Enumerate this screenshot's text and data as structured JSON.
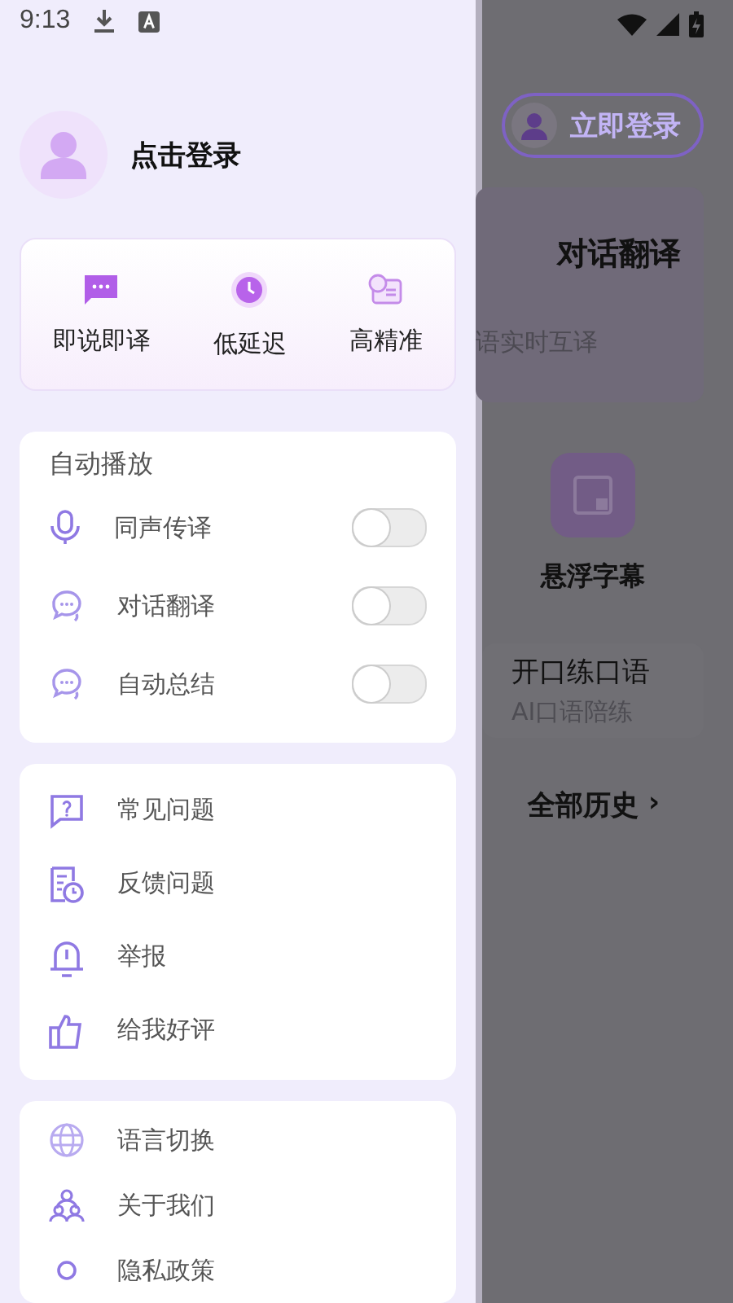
{
  "status_bar": {
    "time": "9:13"
  },
  "drawer": {
    "user": {
      "label": "点击登录"
    },
    "features": [
      {
        "label": "即说即译",
        "kind": "chat"
      },
      {
        "label": "低延迟",
        "kind": "clock"
      },
      {
        "label": "高精准",
        "kind": "doc"
      }
    ],
    "auto_play": {
      "title": "自动播放",
      "items": [
        {
          "label": "同声传译",
          "kind": "mic",
          "on": false
        },
        {
          "label": "对话翻译",
          "kind": "bubbles",
          "on": false
        },
        {
          "label": "自动总结",
          "kind": "bubbles",
          "on": false
        }
      ]
    },
    "menu": [
      {
        "label": "常见问题",
        "kind": "question"
      },
      {
        "label": "反馈问题",
        "kind": "feedback"
      },
      {
        "label": "举报",
        "kind": "bell"
      },
      {
        "label": "给我好评",
        "kind": "thumb"
      }
    ],
    "menu_2": [
      {
        "label": "语言切换",
        "kind": "globe"
      },
      {
        "label": "关于我们",
        "kind": "people"
      },
      {
        "label": "隐私政策",
        "kind": "pin"
      }
    ]
  },
  "main": {
    "login_button": "立即登录",
    "card": {
      "title": "对话翻译",
      "subtitle": "语实时互译"
    },
    "floating": {
      "label": "悬浮字幕"
    },
    "practice": {
      "title": "开口练口语",
      "subtitle": "AI口语陪练"
    },
    "history": {
      "label": "全部历史",
      "chevron": "›"
    }
  }
}
